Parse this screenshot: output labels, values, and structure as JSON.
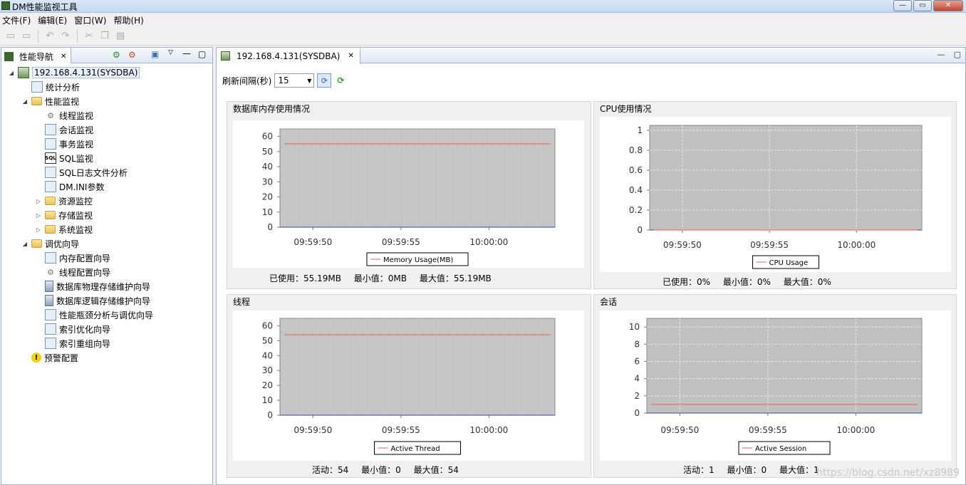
{
  "window": {
    "title": "DM性能监视工具"
  },
  "menu": [
    "文件(F)",
    "编辑(E)",
    "窗口(W)",
    "帮助(H)"
  ],
  "nav": {
    "tab_label": "性能导航",
    "root": "192.168.4.131(SYSDBA)",
    "items": [
      {
        "label": "统计分析",
        "icon": "chart-icon",
        "depth": 1
      },
      {
        "label": "性能监视",
        "icon": "folder-icon",
        "depth": 1,
        "expanded": true
      },
      {
        "label": "线程监视",
        "icon": "gear-icon",
        "depth": 2
      },
      {
        "label": "会话监视",
        "icon": "user-icon",
        "depth": 2
      },
      {
        "label": "事务监视",
        "icon": "table-icon",
        "depth": 2
      },
      {
        "label": "SQL监视",
        "icon": "sql-icon",
        "depth": 2
      },
      {
        "label": "SQL日志文件分析",
        "icon": "log-icon",
        "depth": 2
      },
      {
        "label": "DM.INI参数",
        "icon": "ini-icon",
        "depth": 2
      },
      {
        "label": "资源监控",
        "icon": "folder-icon",
        "depth": 2,
        "collapsed": true
      },
      {
        "label": "存储监视",
        "icon": "folder-icon",
        "depth": 2,
        "collapsed": true
      },
      {
        "label": "系统监视",
        "icon": "folder-icon",
        "depth": 2,
        "collapsed": true
      },
      {
        "label": "调优向导",
        "icon": "folder-icon",
        "depth": 1,
        "expanded": true
      },
      {
        "label": "内存配置向导",
        "icon": "memory-icon",
        "depth": 2
      },
      {
        "label": "线程配置向导",
        "icon": "gear-icon",
        "depth": 2
      },
      {
        "label": "数据库物理存储维护向导",
        "icon": "db-icon",
        "depth": 2
      },
      {
        "label": "数据库逻辑存储维护向导",
        "icon": "db-icon",
        "depth": 2
      },
      {
        "label": "性能瓶颈分析与调优向导",
        "icon": "chart-icon",
        "depth": 2
      },
      {
        "label": "索引优化向导",
        "icon": "index-icon",
        "depth": 2
      },
      {
        "label": "索引重组向导",
        "icon": "index-icon",
        "depth": 2
      },
      {
        "label": "预警配置",
        "icon": "warning-icon",
        "depth": 1
      }
    ]
  },
  "editor": {
    "tab_label": "192.168.4.131(SYSDBA)",
    "refresh_label": "刷新间隔(秒)",
    "refresh_value": "15"
  },
  "panels": {
    "memory": {
      "title": "数据库内存使用情况",
      "stats": [
        "已使用：55.19MB",
        "最小值：0MB",
        "最大值：55.19MB"
      ]
    },
    "cpu": {
      "title": "CPU使用情况",
      "stats": [
        "已使用：0%",
        "最小值：0%",
        "最大值：0%"
      ]
    },
    "thread": {
      "title": "线程",
      "stats": [
        "活动：54",
        "最小值：0",
        "最大值：54"
      ]
    },
    "session": {
      "title": "会话",
      "stats": [
        "活动：1",
        "最小值：0",
        "最大值：1"
      ]
    }
  },
  "chart_data": [
    {
      "type": "line",
      "x": [
        "09:59:50",
        "09:59:55",
        "10:00:00"
      ],
      "ylim": [
        0,
        65
      ],
      "yticks": [
        0,
        10,
        20,
        30,
        40,
        50,
        60
      ],
      "series": [
        {
          "name": "Memory Usage(MB)",
          "values": [
            55.19,
            55.19,
            55.19
          ],
          "color": "#ff5555"
        }
      ],
      "baseline": 0,
      "grid": "dense"
    },
    {
      "type": "line",
      "x": [
        "09:59:50",
        "09:59:55",
        "10:00:00"
      ],
      "ylim": [
        0,
        1.05
      ],
      "yticks": [
        "0",
        "0.2",
        "0.4",
        "0.6",
        "0.8",
        "1"
      ],
      "series": [
        {
          "name": "CPU Usage",
          "values": [
            0,
            0,
            0
          ],
          "color": "#ff5555"
        }
      ],
      "baseline": 0,
      "grid": "dashed"
    },
    {
      "type": "line",
      "x": [
        "09:59:50",
        "09:59:55",
        "10:00:00"
      ],
      "ylim": [
        0,
        65
      ],
      "yticks": [
        0,
        10,
        20,
        30,
        40,
        50,
        60
      ],
      "series": [
        {
          "name": "Active Thread",
          "values": [
            54,
            54,
            54
          ],
          "color": "#ff5555"
        }
      ],
      "baseline": 0,
      "grid": "dense"
    },
    {
      "type": "line",
      "x": [
        "09:59:50",
        "09:59:55",
        "10:00:00"
      ],
      "ylim": [
        0,
        11
      ],
      "yticks": [
        0,
        2,
        4,
        6,
        8,
        10
      ],
      "series": [
        {
          "name": "Active Session",
          "values": [
            1,
            1,
            1
          ],
          "color": "#ff5555"
        }
      ],
      "baseline": 0,
      "grid": "dashed"
    }
  ],
  "watermark": "https://blog.csdn.net/xz8989",
  "colors": {
    "plot_bg": "#c0c0c0",
    "series": "#ff5555",
    "baseline": "#3344aa"
  }
}
